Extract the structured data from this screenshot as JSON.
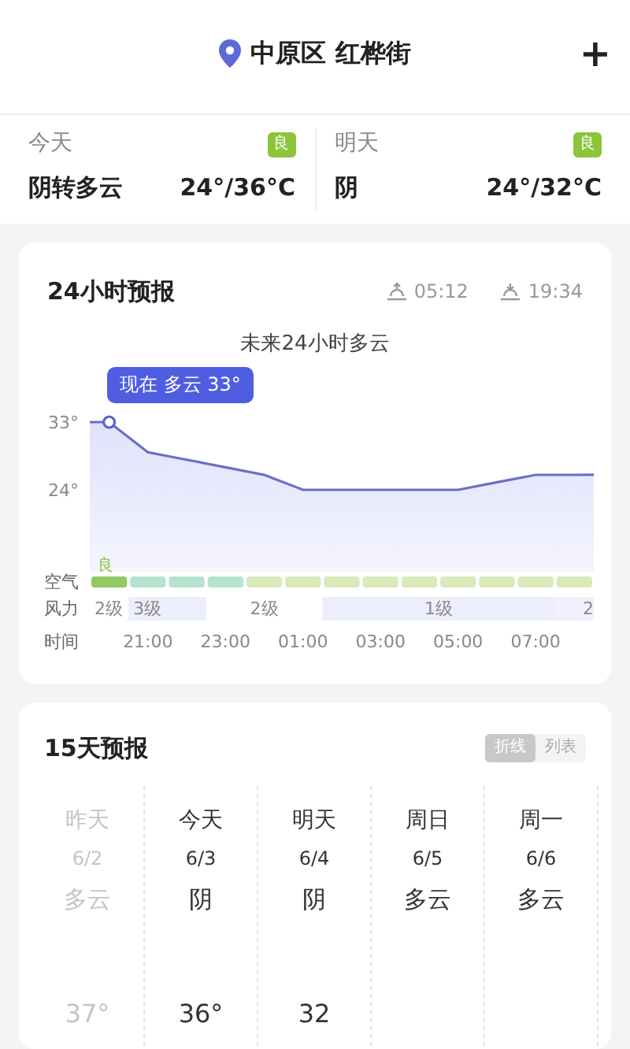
{
  "header": {
    "location": "中原区 红桦街",
    "add": "+"
  },
  "summary": [
    {
      "day": "今天",
      "aqi": "良",
      "weather": "阴转多云",
      "temp": "24°/36°C"
    },
    {
      "day": "明天",
      "aqi": "良",
      "weather": "阴",
      "temp": "24°/32°C"
    }
  ],
  "hourly": {
    "title": "24小时预报",
    "sunrise": "05:12",
    "sunset": "19:34",
    "subtitle": "未来24小时多云",
    "tooltip": "现在 多云 33°",
    "row_labels": [
      "空气",
      "风力",
      "时间"
    ],
    "temp_labels": [
      "33°",
      "24°"
    ],
    "times": [
      "21:00",
      "23:00",
      "01:00",
      "03:00",
      "05:00",
      "07:00"
    ],
    "air": [
      {
        "color": "#93c961",
        "label": "良"
      },
      {
        "color": "#b5e3cf"
      },
      {
        "color": "#b5e3cf"
      },
      {
        "color": "#b5e3cf"
      },
      {
        "color": "#d7eab8"
      },
      {
        "color": "#d7eab8"
      },
      {
        "color": "#d7eab8"
      },
      {
        "color": "#d7eab8"
      },
      {
        "color": "#d7eab8"
      },
      {
        "color": "#d7eab8"
      },
      {
        "color": "#d7eab8"
      },
      {
        "color": "#d7eab8"
      },
      {
        "color": "#d7eab8"
      }
    ],
    "wind": [
      {
        "label": "2级"
      },
      {
        "label": "3级"
      },
      {
        "label": "2级"
      },
      {
        "label": "1级"
      },
      {
        "label": "2"
      }
    ]
  },
  "daily": {
    "title": "15天预报",
    "views": [
      {
        "label": "折线",
        "selected": true
      },
      {
        "label": "列表",
        "selected": false
      }
    ],
    "days": [
      {
        "name": "昨天",
        "date": "6/2",
        "weather": "多云",
        "temp": "37°",
        "past": true
      },
      {
        "name": "今天",
        "date": "6/3",
        "weather": "阴",
        "temp": "36°",
        "past": false
      },
      {
        "name": "明天",
        "date": "6/4",
        "weather": "阴",
        "temp": "32",
        "past": false
      },
      {
        "name": "周日",
        "date": "6/5",
        "weather": "多云",
        "past": false
      },
      {
        "name": "周一",
        "date": "6/6",
        "weather": "多云",
        "past": false
      }
    ]
  }
}
